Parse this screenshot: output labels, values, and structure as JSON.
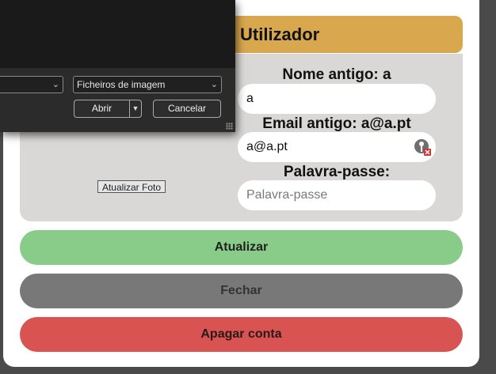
{
  "modal": {
    "title": "Utilizador",
    "photo_button": "Atualizar Foto",
    "fields": [
      {
        "label": "Nome antigo: a",
        "value": "a",
        "placeholder": ""
      },
      {
        "label": "Email antigo: a@a.pt",
        "value": "a@a.pt",
        "placeholder": "",
        "icon": "autofill-key-icon"
      },
      {
        "label": "Palavra-passe:",
        "value": "",
        "placeholder": "Palavra-passe"
      }
    ],
    "buttons": {
      "update": "Atualizar",
      "close": "Fechar",
      "delete": "Apagar conta"
    }
  },
  "file_dialog": {
    "filename_value": "",
    "filter_value": "Ficheiros de imagem",
    "open_label": "Abrir",
    "cancel_label": "Cancelar"
  },
  "colors": {
    "title_bar": "#d9a74e",
    "update": "#89cc8a",
    "close": "#797878",
    "delete": "#d95353",
    "panel": "#dad8d7"
  }
}
